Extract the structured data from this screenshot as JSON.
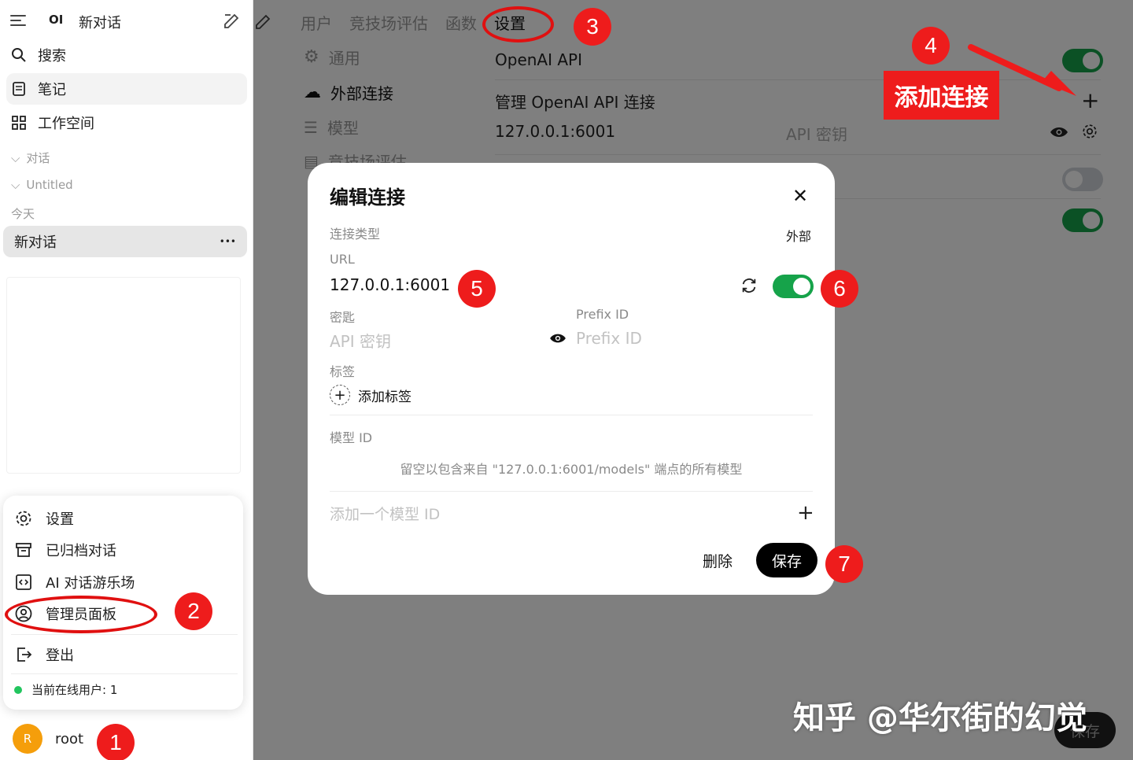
{
  "sidebar": {
    "brand": "OI",
    "new_chat": "新对话",
    "search": "搜索",
    "notes": "笔记",
    "workspace": "工作空间",
    "group_chats": "对话",
    "group_untitled": "Untitled",
    "today": "今天",
    "chat_item": "新对话",
    "chat_more": "•••",
    "menu": {
      "settings": "设置",
      "archived": "已归档对话",
      "playground": "AI 对话游乐场",
      "admin": "管理员面板",
      "logout": "登出",
      "online_users": "当前在线用户: 1"
    },
    "user": {
      "initial": "R",
      "name": "root"
    }
  },
  "main": {
    "tabs": [
      "用户",
      "竞技场评估",
      "函数",
      "设置"
    ],
    "settings_nav": [
      "通用",
      "外部连接",
      "模型",
      "竞技场评估"
    ],
    "openai_api": "OpenAI API",
    "manage_label": "管理 OpenAI API 连接",
    "connection_url": "127.0.0.1:6001",
    "api_key_label": "API 密钥",
    "bg_save": "保存"
  },
  "modal": {
    "title": "编辑连接",
    "conn_type_label": "连接类型",
    "conn_type_value": "外部",
    "url_label": "URL",
    "url_value": "127.0.0.1:6001",
    "key_label": "密匙",
    "key_placeholder": "API 密钥",
    "prefix_label": "Prefix ID",
    "prefix_placeholder": "Prefix ID",
    "tags_label": "标签",
    "add_tag": "添加标签",
    "model_id_label": "模型 ID",
    "model_hint": "留空以包含来自 \"127.0.0.1:6001/models\" 端点的所有模型",
    "add_model_placeholder": "添加一个模型 ID",
    "delete": "删除",
    "save": "保存"
  },
  "annotations": {
    "badges": [
      "1",
      "2",
      "3",
      "4",
      "5",
      "6",
      "7"
    ],
    "add_connection_label": "添加连接",
    "watermark": "知乎 @华尔街的幻觉",
    "accent": "#ee1c1c"
  }
}
